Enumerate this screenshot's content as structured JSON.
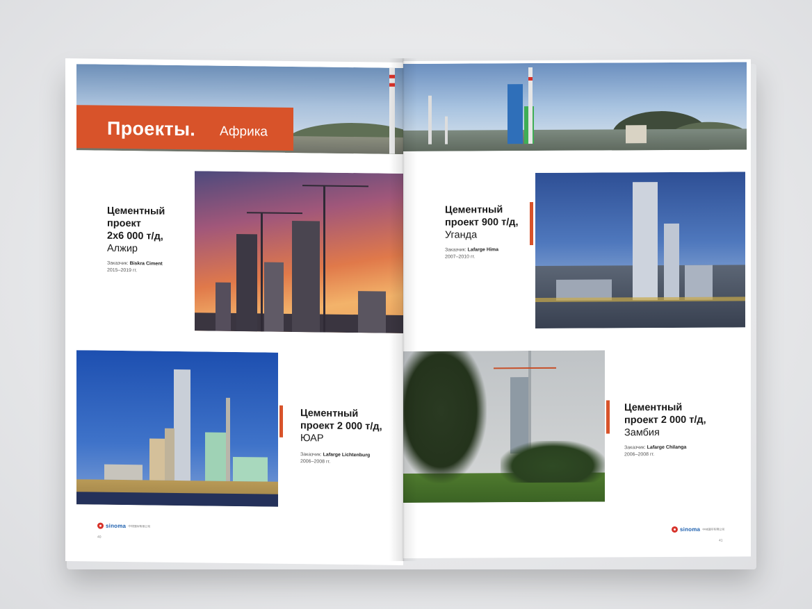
{
  "section": {
    "title": "Проекты.",
    "subtitle": "Африка"
  },
  "projects": [
    {
      "title_line1": "Цементный",
      "title_line2": "проект",
      "title_line3": "2x6 000 т/д,",
      "location": "Алжир",
      "client_label": "Заказчик:",
      "client": "Biskra Ciment",
      "years": "2015–2019 гг."
    },
    {
      "title_line1": "Цементный",
      "title_line2": "проект 900 т/д,",
      "location": "Уганда",
      "client_label": "Заказчик:",
      "client": "Lafarge Hima",
      "years": "2007–2010 гг."
    },
    {
      "title_line1": "Цементный",
      "title_line2": "проект 2 000 т/д,",
      "location": "ЮАР",
      "client_label": "Заказчик:",
      "client": "Lafarge Lichtenburg",
      "years": "2006–2008 гг."
    },
    {
      "title_line1": "Цементный",
      "title_line2": "проект 2 000 т/д,",
      "location": "Замбия",
      "client_label": "Заказчик:",
      "client": "Lafarge Chilanga",
      "years": "2006–2008 гг."
    }
  ],
  "brand": {
    "name": "sinoma",
    "cn": "中材国际有限公司"
  },
  "pages": {
    "left": "40",
    "right": "41"
  },
  "colors": {
    "accent": "#d8532a",
    "brand_blue": "#1c5fae",
    "brand_red": "#d7322a"
  }
}
